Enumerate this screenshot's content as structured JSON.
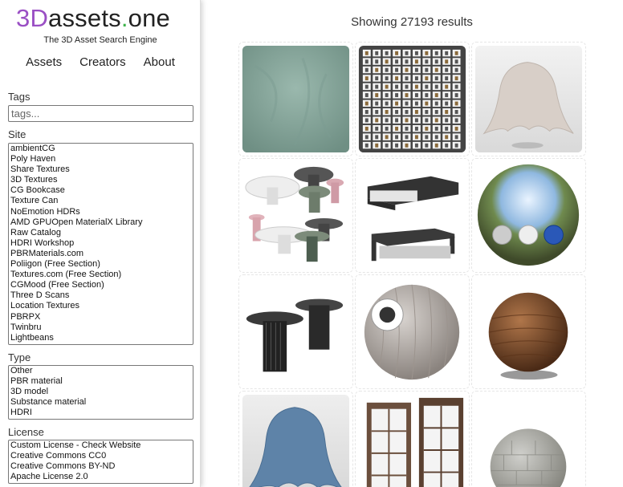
{
  "logo": {
    "part1": "3D",
    "part2": "assets",
    "dot": ".",
    "part3": "one"
  },
  "tagline": "The 3D Asset Search Engine",
  "nav": [
    "Assets",
    "Creators",
    "About"
  ],
  "tags": {
    "label": "Tags",
    "placeholder": "tags..."
  },
  "site": {
    "label": "Site",
    "options": [
      "ambientCG",
      "Poly Haven",
      "Share Textures",
      "3D Textures",
      "CG Bookcase",
      "Texture Can",
      "NoEmotion HDRs",
      "AMD GPUOpen MaterialX Library",
      "Raw Catalog",
      "HDRI Workshop",
      "PBRMaterials.com",
      "Poliigon (Free Section)",
      "Textures.com (Free Section)",
      "CGMood (Free Section)",
      "Three D Scans",
      "Location Textures",
      "PBRPX",
      "Twinbru",
      "Lightbeans"
    ]
  },
  "type": {
    "label": "Type",
    "options": [
      "Other",
      "PBR material",
      "3D model",
      "Substance material",
      "HDRI"
    ]
  },
  "license": {
    "label": "License",
    "options": [
      "Custom License - Check Website",
      "Creative Commons CC0",
      "Creative Commons BY-ND",
      "Apache License 2.0"
    ]
  },
  "results": {
    "text": "Showing 27193 results"
  },
  "colors": {
    "logo_purple": "#9a4fc4",
    "logo_green": "#3db34a"
  }
}
